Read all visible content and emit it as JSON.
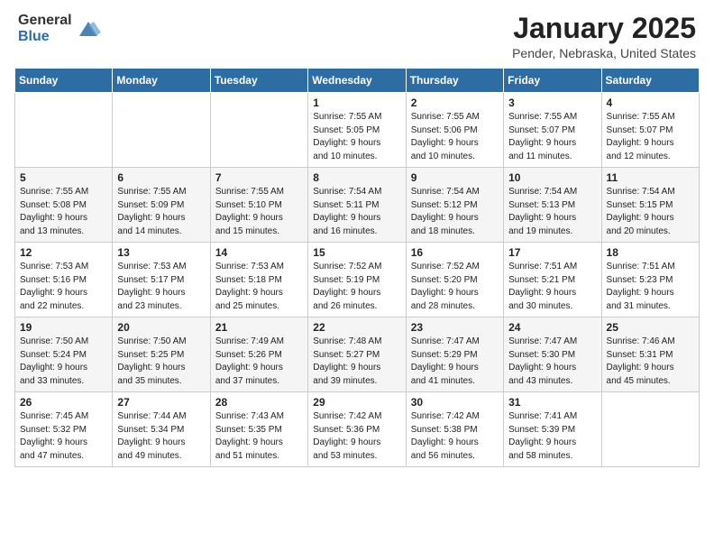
{
  "header": {
    "logo_general": "General",
    "logo_blue": "Blue",
    "title": "January 2025",
    "subtitle": "Pender, Nebraska, United States"
  },
  "calendar": {
    "days_of_week": [
      "Sunday",
      "Monday",
      "Tuesday",
      "Wednesday",
      "Thursday",
      "Friday",
      "Saturday"
    ],
    "weeks": [
      [
        {
          "day": "",
          "info": ""
        },
        {
          "day": "",
          "info": ""
        },
        {
          "day": "",
          "info": ""
        },
        {
          "day": "1",
          "info": "Sunrise: 7:55 AM\nSunset: 5:05 PM\nDaylight: 9 hours\nand 10 minutes."
        },
        {
          "day": "2",
          "info": "Sunrise: 7:55 AM\nSunset: 5:06 PM\nDaylight: 9 hours\nand 10 minutes."
        },
        {
          "day": "3",
          "info": "Sunrise: 7:55 AM\nSunset: 5:07 PM\nDaylight: 9 hours\nand 11 minutes."
        },
        {
          "day": "4",
          "info": "Sunrise: 7:55 AM\nSunset: 5:07 PM\nDaylight: 9 hours\nand 12 minutes."
        }
      ],
      [
        {
          "day": "5",
          "info": "Sunrise: 7:55 AM\nSunset: 5:08 PM\nDaylight: 9 hours\nand 13 minutes."
        },
        {
          "day": "6",
          "info": "Sunrise: 7:55 AM\nSunset: 5:09 PM\nDaylight: 9 hours\nand 14 minutes."
        },
        {
          "day": "7",
          "info": "Sunrise: 7:55 AM\nSunset: 5:10 PM\nDaylight: 9 hours\nand 15 minutes."
        },
        {
          "day": "8",
          "info": "Sunrise: 7:54 AM\nSunset: 5:11 PM\nDaylight: 9 hours\nand 16 minutes."
        },
        {
          "day": "9",
          "info": "Sunrise: 7:54 AM\nSunset: 5:12 PM\nDaylight: 9 hours\nand 18 minutes."
        },
        {
          "day": "10",
          "info": "Sunrise: 7:54 AM\nSunset: 5:13 PM\nDaylight: 9 hours\nand 19 minutes."
        },
        {
          "day": "11",
          "info": "Sunrise: 7:54 AM\nSunset: 5:15 PM\nDaylight: 9 hours\nand 20 minutes."
        }
      ],
      [
        {
          "day": "12",
          "info": "Sunrise: 7:53 AM\nSunset: 5:16 PM\nDaylight: 9 hours\nand 22 minutes."
        },
        {
          "day": "13",
          "info": "Sunrise: 7:53 AM\nSunset: 5:17 PM\nDaylight: 9 hours\nand 23 minutes."
        },
        {
          "day": "14",
          "info": "Sunrise: 7:53 AM\nSunset: 5:18 PM\nDaylight: 9 hours\nand 25 minutes."
        },
        {
          "day": "15",
          "info": "Sunrise: 7:52 AM\nSunset: 5:19 PM\nDaylight: 9 hours\nand 26 minutes."
        },
        {
          "day": "16",
          "info": "Sunrise: 7:52 AM\nSunset: 5:20 PM\nDaylight: 9 hours\nand 28 minutes."
        },
        {
          "day": "17",
          "info": "Sunrise: 7:51 AM\nSunset: 5:21 PM\nDaylight: 9 hours\nand 30 minutes."
        },
        {
          "day": "18",
          "info": "Sunrise: 7:51 AM\nSunset: 5:23 PM\nDaylight: 9 hours\nand 31 minutes."
        }
      ],
      [
        {
          "day": "19",
          "info": "Sunrise: 7:50 AM\nSunset: 5:24 PM\nDaylight: 9 hours\nand 33 minutes."
        },
        {
          "day": "20",
          "info": "Sunrise: 7:50 AM\nSunset: 5:25 PM\nDaylight: 9 hours\nand 35 minutes."
        },
        {
          "day": "21",
          "info": "Sunrise: 7:49 AM\nSunset: 5:26 PM\nDaylight: 9 hours\nand 37 minutes."
        },
        {
          "day": "22",
          "info": "Sunrise: 7:48 AM\nSunset: 5:27 PM\nDaylight: 9 hours\nand 39 minutes."
        },
        {
          "day": "23",
          "info": "Sunrise: 7:47 AM\nSunset: 5:29 PM\nDaylight: 9 hours\nand 41 minutes."
        },
        {
          "day": "24",
          "info": "Sunrise: 7:47 AM\nSunset: 5:30 PM\nDaylight: 9 hours\nand 43 minutes."
        },
        {
          "day": "25",
          "info": "Sunrise: 7:46 AM\nSunset: 5:31 PM\nDaylight: 9 hours\nand 45 minutes."
        }
      ],
      [
        {
          "day": "26",
          "info": "Sunrise: 7:45 AM\nSunset: 5:32 PM\nDaylight: 9 hours\nand 47 minutes."
        },
        {
          "day": "27",
          "info": "Sunrise: 7:44 AM\nSunset: 5:34 PM\nDaylight: 9 hours\nand 49 minutes."
        },
        {
          "day": "28",
          "info": "Sunrise: 7:43 AM\nSunset: 5:35 PM\nDaylight: 9 hours\nand 51 minutes."
        },
        {
          "day": "29",
          "info": "Sunrise: 7:42 AM\nSunset: 5:36 PM\nDaylight: 9 hours\nand 53 minutes."
        },
        {
          "day": "30",
          "info": "Sunrise: 7:42 AM\nSunset: 5:38 PM\nDaylight: 9 hours\nand 56 minutes."
        },
        {
          "day": "31",
          "info": "Sunrise: 7:41 AM\nSunset: 5:39 PM\nDaylight: 9 hours\nand 58 minutes."
        },
        {
          "day": "",
          "info": ""
        }
      ]
    ]
  }
}
